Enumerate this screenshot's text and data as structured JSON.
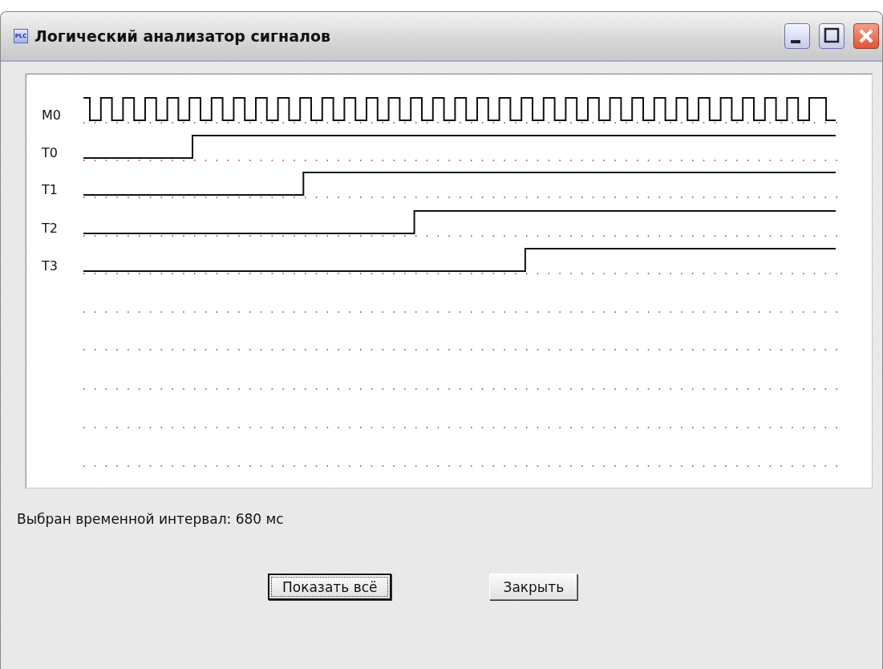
{
  "window": {
    "icon_text": "PLC",
    "title": "Логический анализатор сигналов"
  },
  "signals": [
    {
      "name": "M0",
      "kind": "clock"
    },
    {
      "name": "T0",
      "kind": "step"
    },
    {
      "name": "T1",
      "kind": "step"
    },
    {
      "name": "T2",
      "kind": "step"
    },
    {
      "name": "T3",
      "kind": "step"
    }
  ],
  "status": "Выбран временной интервал:  680 мс",
  "buttons": [
    {
      "label": "Показать всё",
      "focused": true
    },
    {
      "label": "Закрыть",
      "focused": false
    }
  ]
}
